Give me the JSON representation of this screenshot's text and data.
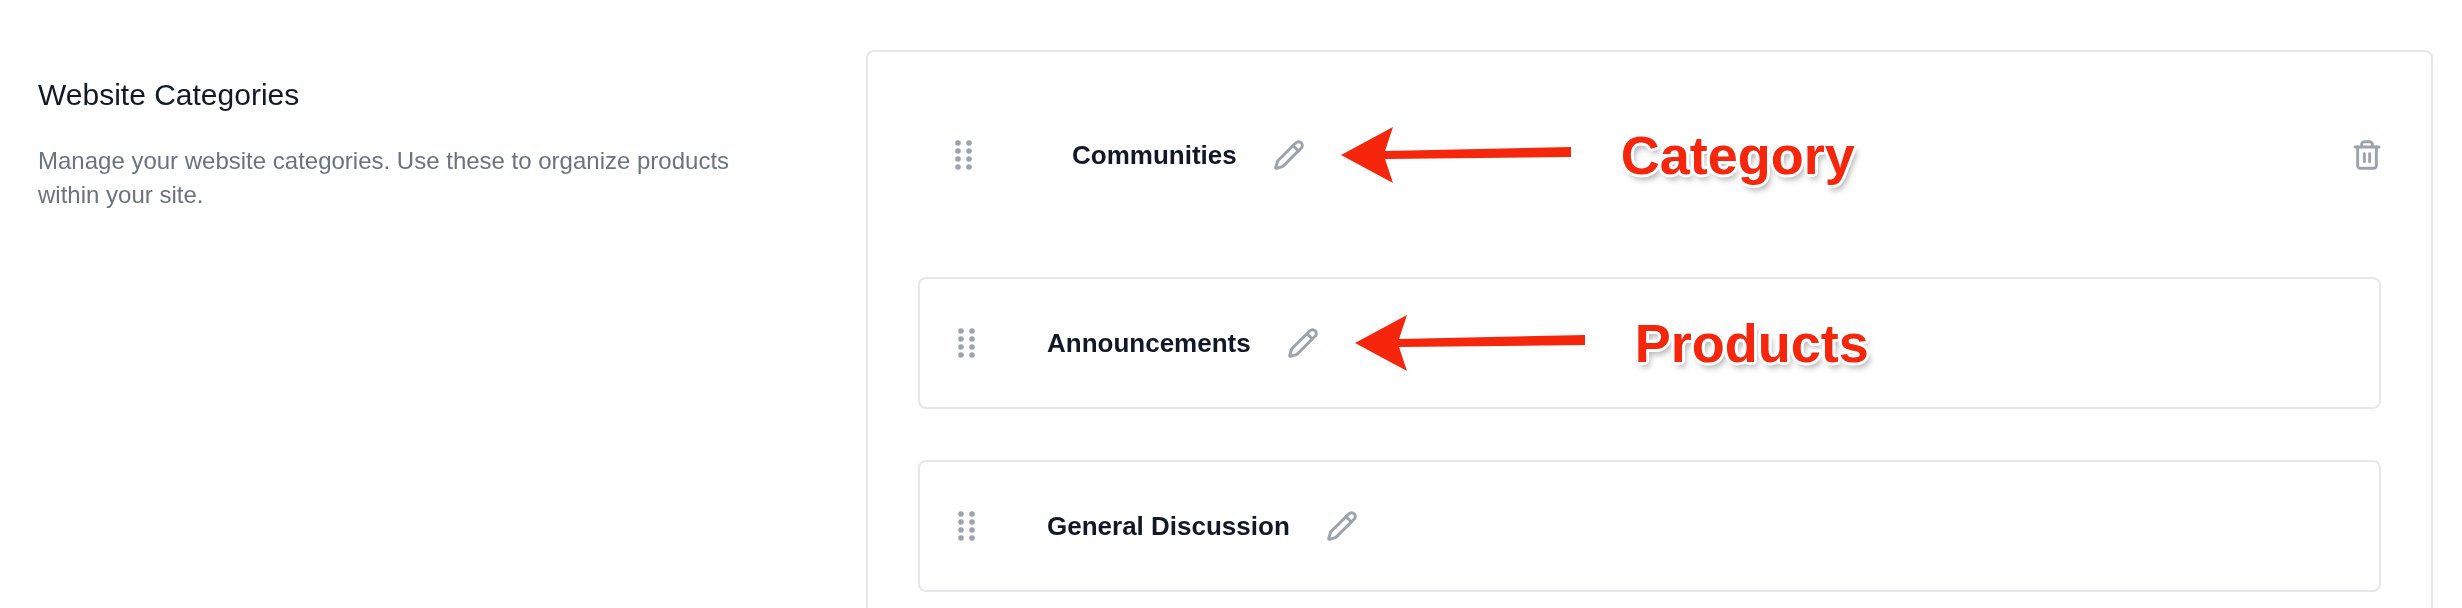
{
  "section": {
    "title": "Website Categories",
    "description": "Manage your website categories. Use these to organize products within your site."
  },
  "category": {
    "name": "Communities",
    "annotation": {
      "label": "Category"
    }
  },
  "products": [
    {
      "name": "Announcements",
      "annotation": {
        "label": "Products"
      }
    },
    {
      "name": "General Discussion"
    }
  ]
}
